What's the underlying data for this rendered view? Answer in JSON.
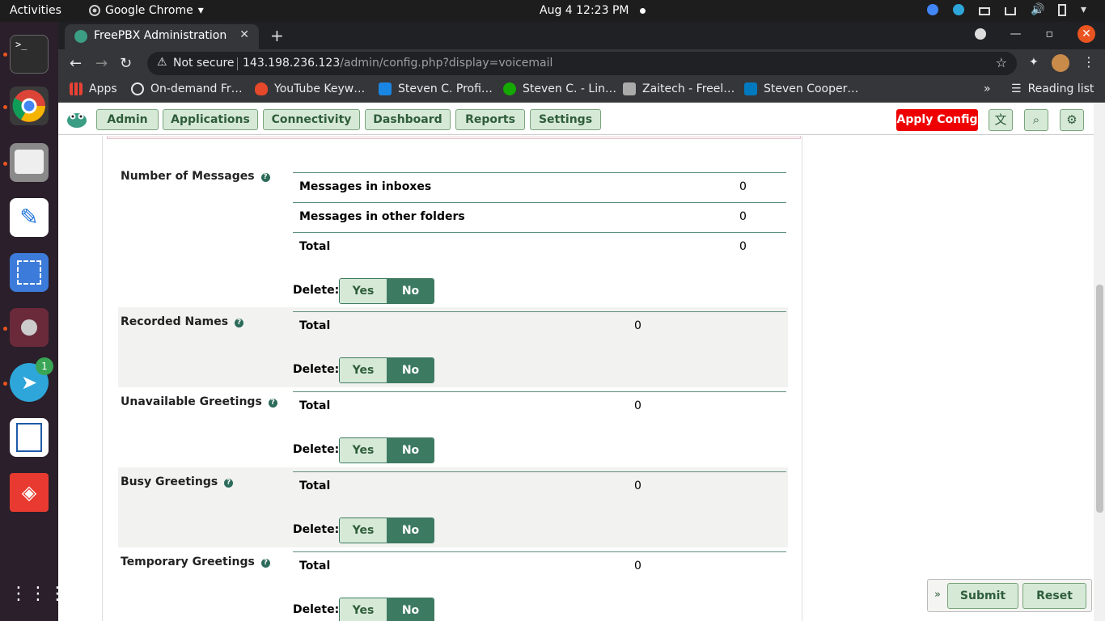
{
  "topbar": {
    "activities": "Activities",
    "app_name": "Google Chrome",
    "clock": "Aug 4  12:23 PM"
  },
  "dock": {
    "telegram_badge": "1"
  },
  "browser": {
    "tab_title": "FreePBX Administration",
    "address_warning": "Not secure",
    "url_host": "143.198.236.123",
    "url_path": "/admin/config.php?display=voicemail",
    "bookmarks": [
      "Apps",
      "On-demand Fr…",
      "YouTube Keyw…",
      "Steven C. Profi…",
      "Steven C. - Lin…",
      "Zaitech - Freel…",
      "Steven Cooper…"
    ],
    "reading_list": "Reading list"
  },
  "nav": {
    "tabs": [
      "Admin",
      "Applications",
      "Connectivity",
      "Dashboard",
      "Reports",
      "Settings"
    ],
    "apply_config": "Apply Config"
  },
  "sections": {
    "messages": {
      "label": "Number of Messages",
      "rows": [
        {
          "key": "Messages in inboxes",
          "value": "0"
        },
        {
          "key": "Messages in other folders",
          "value": "0"
        },
        {
          "key": "Total",
          "value": "0"
        }
      ]
    },
    "recorded_names": {
      "label": "Recorded Names",
      "total_label": "Total",
      "total": "0"
    },
    "unavailable": {
      "label": "Unavailable Greetings",
      "total_label": "Total",
      "total": "0"
    },
    "busy": {
      "label": "Busy Greetings",
      "total_label": "Total",
      "total": "0"
    },
    "temporary": {
      "label": "Temporary Greetings",
      "total_label": "Total",
      "total": "0"
    }
  },
  "delete": {
    "label": "Delete:",
    "yes": "Yes",
    "no": "No"
  },
  "actions": {
    "submit": "Submit",
    "reset": "Reset"
  },
  "colors": {
    "accent": "#3d7a62",
    "apply": "#ee0000",
    "nav_bg": "#d6e9d7"
  }
}
